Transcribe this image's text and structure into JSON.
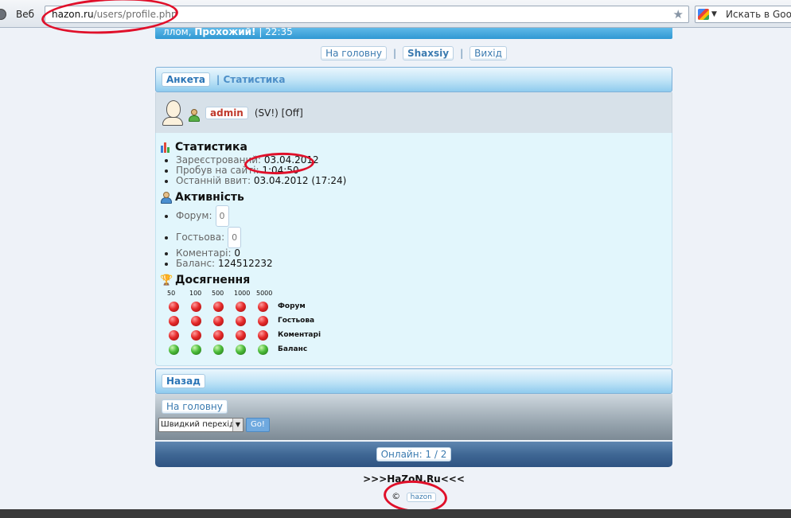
{
  "browser": {
    "tab_label": "Веб",
    "url_host": "hazon.ru",
    "url_path": "/users/profile.php",
    "search_placeholder": "Искать в Google"
  },
  "header": {
    "greeting_prefix": "ллом,",
    "guest_name": "Прохожий!",
    "time": "| 22:35"
  },
  "nav": {
    "home": "На головну",
    "user": "Shaxsiy",
    "exit": "Вихід",
    "sep": "|"
  },
  "tabs": {
    "profile": "Анкета",
    "stats": "| Статистика"
  },
  "user": {
    "name": "admin",
    "status": "(SV!) [Off]"
  },
  "stats": {
    "title": "Статистика",
    "registered_label": "Зареєстрований:",
    "registered_value": "03.04.2012",
    "time_on_site_label": "Пробув на сайті:",
    "time_on_site_value": "1:04:50",
    "last_visit_label": "Останній ввит:",
    "last_visit_value": "03.04.2012 (17:24)"
  },
  "activity": {
    "title": "Активність",
    "forum_label": "Форум:",
    "forum_value": "0",
    "guestbook_label": "Гостьова:",
    "guestbook_value": "0",
    "comments_label": "Коментарі:",
    "comments_value": "0",
    "balance_label": "Баланс:",
    "balance_value": "124512232"
  },
  "achievements": {
    "title": "Досягнення",
    "thresholds": [
      "50",
      "100",
      "500",
      "1000",
      "5000"
    ],
    "rows": [
      {
        "label": "Форум",
        "states": [
          "red",
          "red",
          "red",
          "red",
          "red"
        ]
      },
      {
        "label": "Гостьова",
        "states": [
          "red",
          "red",
          "red",
          "red",
          "red"
        ]
      },
      {
        "label": "Коментарі",
        "states": [
          "red",
          "red",
          "red",
          "red",
          "red"
        ]
      },
      {
        "label": "Баланс",
        "states": [
          "green",
          "green",
          "green",
          "green",
          "green"
        ]
      }
    ],
    "colors": {
      "red": "#e52a2a",
      "green": "#4cbc3a"
    }
  },
  "back": {
    "label": "Назад"
  },
  "footer_nav": {
    "home": "На головну",
    "quick_jump": "Швидкий перехід",
    "go": "Go!",
    "online": "Онлайн: 1 / 2"
  },
  "footer": {
    "site_title": ">>>HaZoN.Ru<<<",
    "copyright_symbol": "©",
    "owner": "hazon"
  }
}
